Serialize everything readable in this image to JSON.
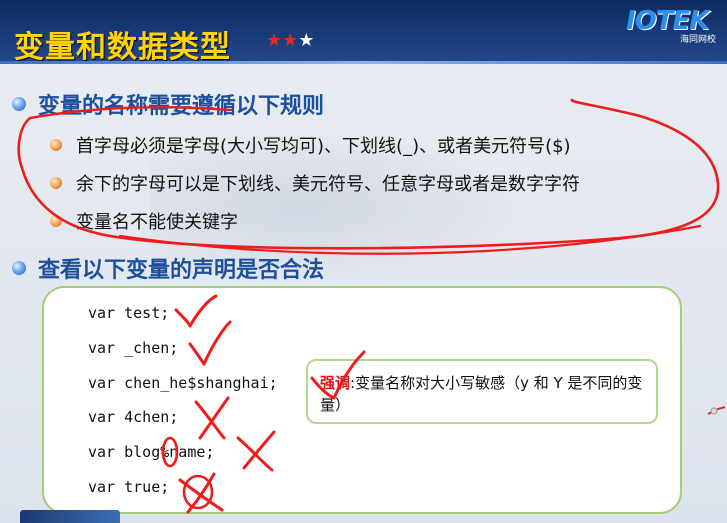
{
  "header": {
    "title": "变量和数据类型",
    "stars": [
      "★",
      "★",
      "★"
    ],
    "logo_text": "IOTEK",
    "logo_sub": "海同网校"
  },
  "bullets": [
    {
      "text": "变量的名称需要遵循以下规则",
      "sub": [
        "首字母必须是字母(大小写均可)、下划线(_)、或者美元符号($)",
        "余下的字母可以是下划线、美元符号、任意字母或者是数字字符",
        "变量名不能使关键字"
      ]
    },
    {
      "text": "查看以下变量的声明是否合法"
    }
  ],
  "code": [
    "var test;",
    "var _chen;",
    "var chen_he$shanghai;",
    "var 4chen;",
    "var blog%name;",
    "var true;"
  ],
  "note": {
    "label": "强调",
    "text": ":变量名称对大小写敏感（y 和 Y 是不同的变量）"
  },
  "colors": {
    "title": "#ffd400",
    "heading": "#1e4f9c",
    "ink": "#ee1c1c",
    "box_border": "#a2cc76"
  }
}
